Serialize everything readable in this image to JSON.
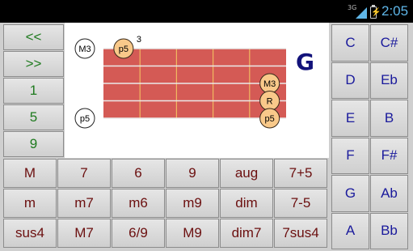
{
  "status": {
    "network": "3G",
    "time": "2:05"
  },
  "nav": {
    "prev_label": "<<",
    "next_label": ">>",
    "items": [
      "1",
      "5",
      "9"
    ]
  },
  "fretboard": {
    "chord_name": "G",
    "fret_number": "3",
    "side_labels": [
      {
        "label": "M3",
        "string_index": 0
      },
      {
        "label": "p5",
        "string_index": 4
      }
    ],
    "notes": [
      {
        "label": "p5",
        "string_index": 0,
        "fret_index": 0
      },
      {
        "label": "M3",
        "string_index": 2,
        "fret_index": 4
      },
      {
        "label": "R",
        "string_index": 3,
        "fret_index": 4
      },
      {
        "label": "p5",
        "string_index": 4,
        "fret_index": 4
      }
    ],
    "colors": {
      "board": "#d45a55",
      "fret": "#f0b860",
      "string": "#eaeaea",
      "note_fill": "#f9c98a",
      "note_stroke": "#3a2a1a"
    }
  },
  "chords": {
    "row1": [
      "M",
      "7",
      "6",
      "9",
      "aug",
      "7+5"
    ],
    "row2": [
      "m",
      "m7",
      "m6",
      "m9",
      "dim",
      "7-5"
    ],
    "row3": [
      "sus4",
      "M7",
      "6/9",
      "M9",
      "dim7",
      "7sus4"
    ]
  },
  "notes_grid": [
    [
      "C",
      "C#"
    ],
    [
      "D",
      "Eb"
    ],
    [
      "E",
      "B"
    ],
    [
      "F",
      "F#"
    ],
    [
      "G",
      "Ab"
    ],
    [
      "A",
      "Bb"
    ]
  ]
}
